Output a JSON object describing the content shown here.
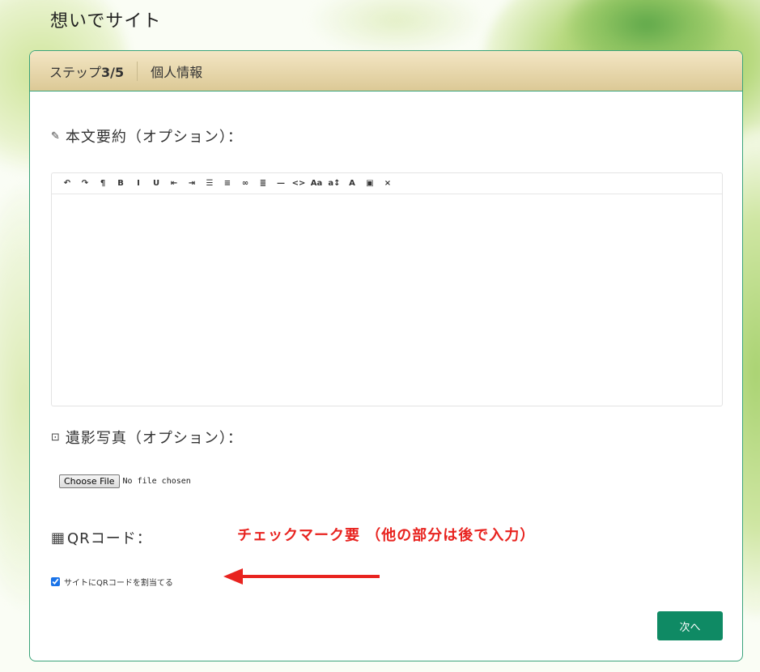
{
  "site": {
    "title": "想いでサイト"
  },
  "header": {
    "step_prefix": "ステップ",
    "step_value": "3/5",
    "step_name": "個人情報"
  },
  "summary": {
    "icon": "pencil-icon",
    "label": "本文要約（オプション）："
  },
  "toolbar": [
    {
      "name": "undo-icon",
      "glyph": "↶"
    },
    {
      "name": "redo-icon",
      "glyph": "↷"
    },
    {
      "name": "paragraph-icon",
      "glyph": "¶"
    },
    {
      "name": "bold-icon",
      "glyph": "B"
    },
    {
      "name": "italic-icon",
      "glyph": "I"
    },
    {
      "name": "underline-icon",
      "glyph": "U"
    },
    {
      "name": "outdent-icon",
      "glyph": "⇤"
    },
    {
      "name": "indent-icon",
      "glyph": "⇥"
    },
    {
      "name": "bullet-list-icon",
      "glyph": "☰"
    },
    {
      "name": "numbered-list-icon",
      "glyph": "≡"
    },
    {
      "name": "link-icon",
      "glyph": "∞"
    },
    {
      "name": "align-icon",
      "glyph": "≣"
    },
    {
      "name": "horizontal-rule-icon",
      "glyph": "—"
    },
    {
      "name": "code-icon",
      "glyph": "<>"
    },
    {
      "name": "font-family-icon",
      "glyph": "Aa"
    },
    {
      "name": "font-size-icon",
      "glyph": "a↕"
    },
    {
      "name": "text-color-icon",
      "glyph": "A"
    },
    {
      "name": "background-color-icon",
      "glyph": "▣"
    },
    {
      "name": "clear-format-icon",
      "glyph": "×"
    }
  ],
  "photo": {
    "icon": "image-icon",
    "label": "遺影写真（オプション）："
  },
  "file": {
    "button": "Choose File",
    "status": "No file chosen"
  },
  "qr": {
    "label": "QRコード：",
    "checkbox_label": "サイトにQRコードを割当てる",
    "checked": true
  },
  "annotation": "チェックマーク要 （他の部分は後で入力）",
  "next_button": "次へ",
  "colors": {
    "accent": "#0f8a64",
    "annotation": "#e8231f",
    "border": "#3aa37a"
  }
}
